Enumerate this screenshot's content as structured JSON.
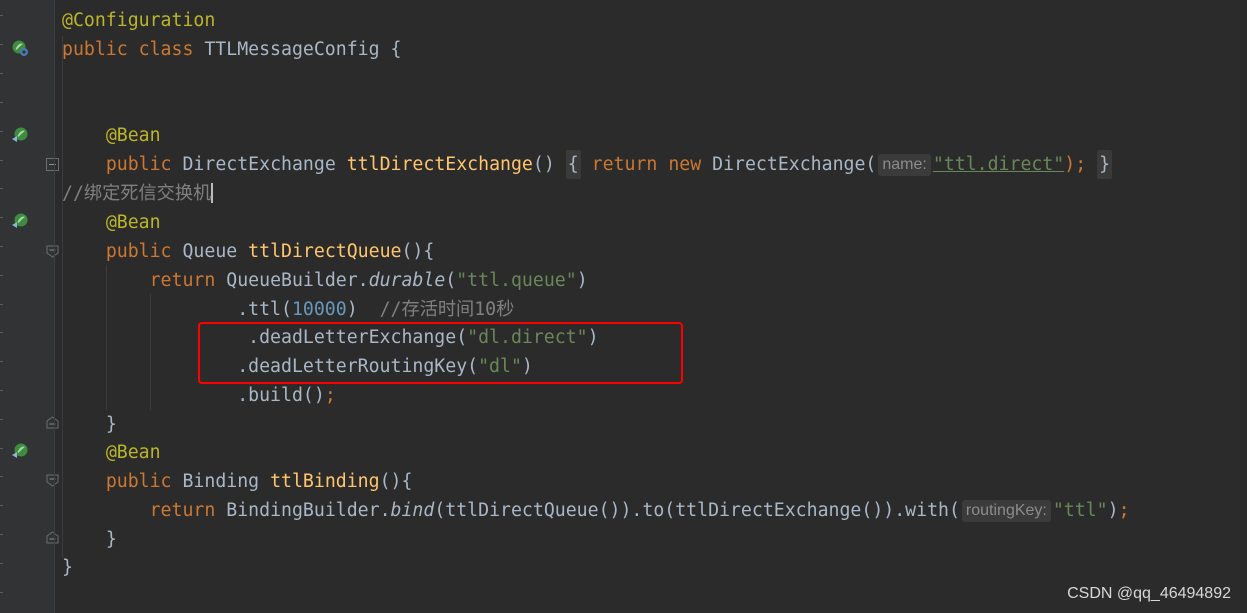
{
  "code": {
    "line1_annotation": "@Configuration",
    "line2": {
      "kw_public": "public",
      "kw_class": "class",
      "class_name": "TTLMessageConfig",
      "brace": "{"
    },
    "line5_annotation": "@Bean",
    "line6": {
      "kw_public": "public",
      "type": "DirectExchange",
      "method": "ttlDirectExchange",
      "parens": "()",
      "fold_open": "{",
      "kw_return": "return",
      "kw_new": "new",
      "ctor": "DirectExchange(",
      "hint_label": "name:",
      "arg": "\"ttl.direct\"",
      "close": ");",
      "fold_close": "}"
    },
    "line7_comment": "//绑定死信交换机",
    "line8_annotation": "@Bean",
    "line9": {
      "kw_public": "public",
      "type": "Queue",
      "method": "ttlDirectQueue",
      "rest": "(){"
    },
    "line10": {
      "kw_return": "return",
      "builder": "QueueBuilder.",
      "static_method": "durable",
      "open": "(",
      "arg": "\"ttl.queue\"",
      "close": ")"
    },
    "line11": {
      "call": ".ttl(",
      "num": "10000",
      "close": ")",
      "comment": "//存活时间10秒"
    },
    "line12": {
      "call": ".deadLetterExchange(",
      "arg": "\"dl.direct\"",
      "close": ")"
    },
    "line13": {
      "call": ".deadLetterRoutingKey(",
      "arg": "\"dl\"",
      "close": ")"
    },
    "line14": {
      "call": ".build()",
      "semi": ";"
    },
    "line15": "}",
    "line16_annotation": "@Bean",
    "line17": {
      "kw_public": "public",
      "type": "Binding",
      "method": "ttlBinding",
      "rest": "(){"
    },
    "line18": {
      "kw_return": "return",
      "builder": "BindingBuilder.",
      "static_method": "bind",
      "chain": "(ttlDirectQueue()).to(ttlDirectExchange()).with(",
      "hint_label": "routingKey:",
      "arg": "\"ttl\"",
      "close": ")",
      "semi": ";"
    },
    "line19": "}",
    "line20": "}"
  },
  "watermark": "CSDN @qq_46494892",
  "icons": {
    "spring_bean": "spring-bean-icon",
    "spring_config": "spring-config-icon",
    "fold": "fold-icon"
  },
  "colors": {
    "background": "#2b2b2b",
    "keyword": "#cc7832",
    "annotation": "#bbb529",
    "method": "#ffc66d",
    "string": "#6a8759",
    "number": "#6897bb",
    "comment": "#808080",
    "highlight_box": "#ff0000"
  }
}
